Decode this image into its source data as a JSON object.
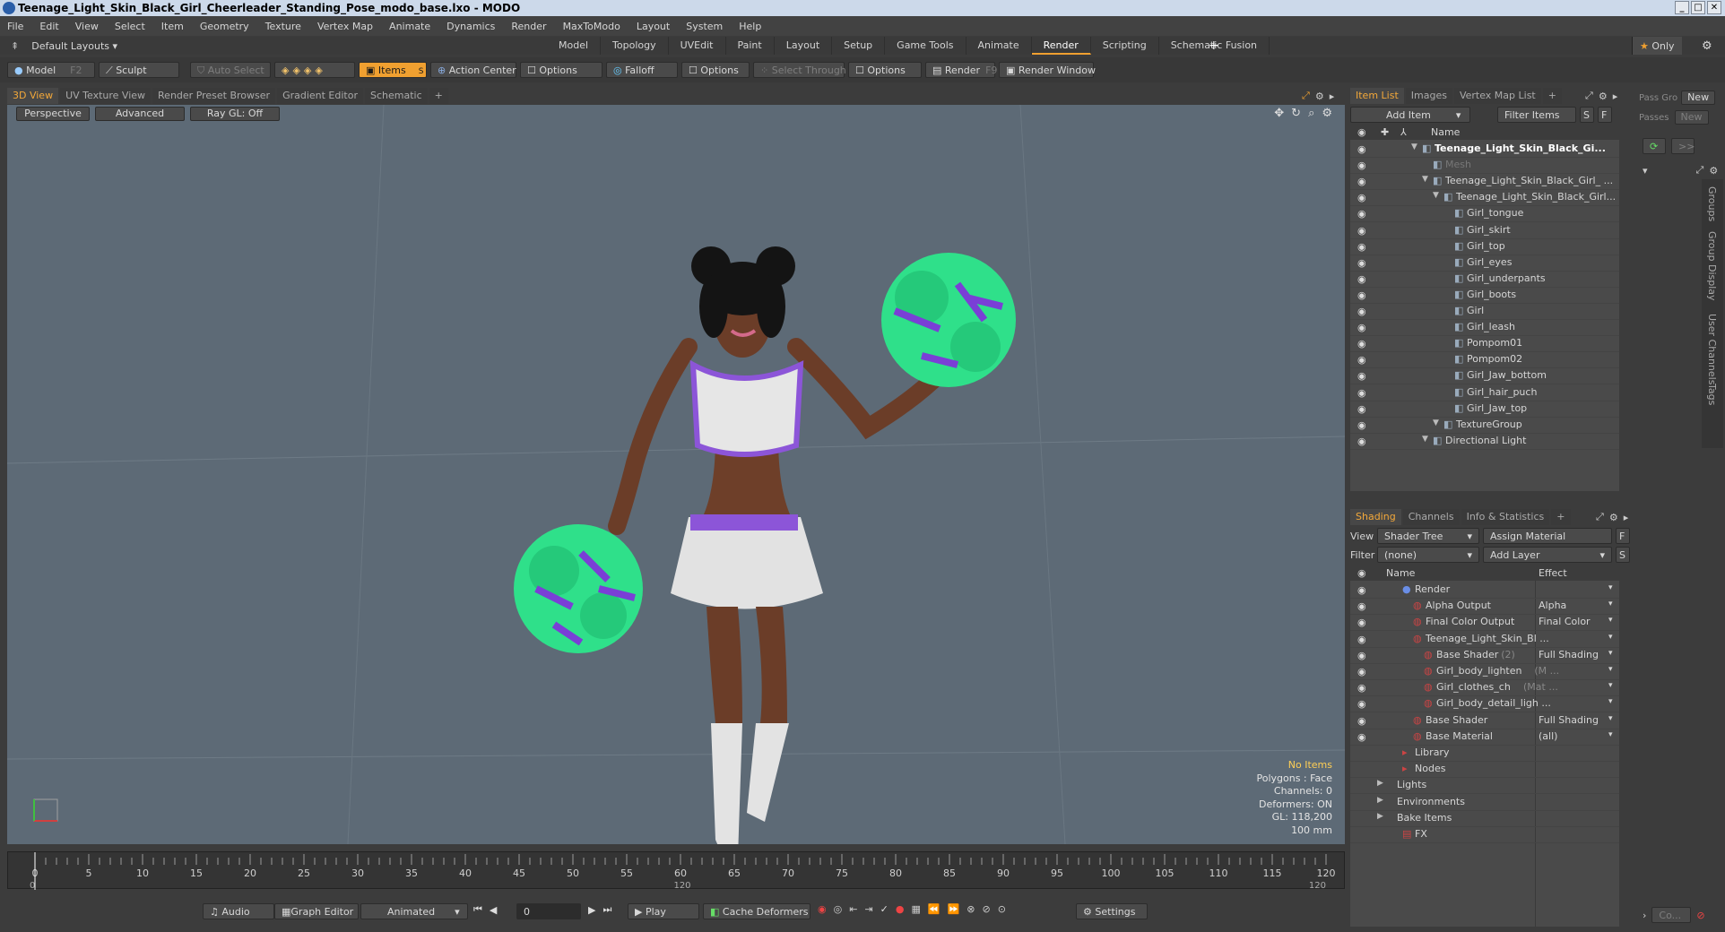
{
  "window": {
    "title": "Teenage_Light_Skin_Black_Girl_Cheerleader_Standing_Pose_modo_base.lxo - MODO"
  },
  "menu": [
    "File",
    "Edit",
    "View",
    "Select",
    "Item",
    "Geometry",
    "Texture",
    "Vertex Map",
    "Animate",
    "Dynamics",
    "Render",
    "MaxToModo",
    "Layout",
    "System",
    "Help"
  ],
  "layout_selector": "Default Layouts",
  "top_tabs": [
    "Model",
    "Topology",
    "UVEdit",
    "Paint",
    "Layout",
    "Setup",
    "Game Tools",
    "Animate",
    "Render",
    "Scripting",
    "Schematic Fusion"
  ],
  "active_top_tab": "Render",
  "only_label": "Only",
  "toolbar": {
    "model": "Model",
    "model_key": "F2",
    "sculpt": "Sculpt",
    "auto_select": "Auto Select",
    "items": "Items",
    "items_key": "S",
    "action_center": "Action Center",
    "options1": "Options",
    "falloff": "Falloff",
    "options2": "Options",
    "select_through": "Select Through",
    "options3": "Options",
    "render": "Render",
    "render_key": "F9",
    "render_window": "Render Window"
  },
  "viewport_tabs": [
    "3D View",
    "UV Texture View",
    "Render Preset Browser",
    "Gradient Editor",
    "Schematic"
  ],
  "viewport_sub": {
    "perspective": "Perspective",
    "advanced": "Advanced",
    "raygl": "Ray GL: Off"
  },
  "viewport_info": {
    "no_items": "No Items",
    "polygons": "Polygons : Face",
    "channels": "Channels: 0",
    "deformers": "Deformers: ON",
    "gl": "GL: 118,200",
    "scale": "100 mm"
  },
  "right_tabs": [
    "Item List",
    "Images",
    "Vertex Map List"
  ],
  "item_list": {
    "add_item": "Add Item",
    "filter_items": "Filter Items",
    "s": "S",
    "f": "F",
    "name_header": "Name"
  },
  "items": [
    {
      "label": "Teenage_Light_Skin_Black_Gi...",
      "indent": 0,
      "bold": true
    },
    {
      "label": "Mesh",
      "indent": 1,
      "dim": true
    },
    {
      "label": "Teenage_Light_Skin_Black_Girl_ ...",
      "indent": 1
    },
    {
      "label": "Teenage_Light_Skin_Black_Girl...",
      "indent": 2
    },
    {
      "label": "Girl_tongue",
      "indent": 3
    },
    {
      "label": "Girl_skirt",
      "indent": 3
    },
    {
      "label": "Girl_top",
      "indent": 3
    },
    {
      "label": "Girl_eyes",
      "indent": 3
    },
    {
      "label": "Girl_underpants",
      "indent": 3
    },
    {
      "label": "Girl_boots",
      "indent": 3
    },
    {
      "label": "Girl",
      "indent": 3
    },
    {
      "label": "Girl_leash",
      "indent": 3
    },
    {
      "label": "Pompom01",
      "indent": 3
    },
    {
      "label": "Pompom02",
      "indent": 3
    },
    {
      "label": "Girl_Jaw_bottom",
      "indent": 3
    },
    {
      "label": "Girl_hair_puch",
      "indent": 3
    },
    {
      "label": "Girl_Jaw_top",
      "indent": 3
    },
    {
      "label": "TextureGroup",
      "indent": 2
    },
    {
      "label": "Directional Light",
      "indent": 1
    }
  ],
  "shading_tabs": [
    "Shading",
    "Channels",
    "Info & Statistics"
  ],
  "shading": {
    "view_label": "View",
    "view_value": "Shader Tree",
    "assign_material": "Assign Material",
    "f": "F",
    "filter_label": "Filter",
    "filter_value": "(none)",
    "add_layer": "Add Layer",
    "s": "S",
    "name_header": "Name",
    "effect_header": "Effect"
  },
  "shader_rows": [
    {
      "label": "Render",
      "effect": "",
      "indent": 0
    },
    {
      "label": "Alpha Output",
      "effect": "Alpha",
      "indent": 1
    },
    {
      "label": "Final Color Output",
      "effect": "Final Color",
      "indent": 1
    },
    {
      "label": "Teenage_Light_Skin_Bl ...",
      "effect": "",
      "indent": 1
    },
    {
      "label": "Base Shader",
      "suffix": "(2)",
      "effect": "Full Shading",
      "indent": 2
    },
    {
      "label": "Girl_body_lighten",
      "suffix": "(M ...",
      "effect": "",
      "indent": 2
    },
    {
      "label": "Girl_clothes_ch",
      "suffix": "(Mat ...",
      "effect": "",
      "indent": 2
    },
    {
      "label": "Girl_body_detail_ligh ...",
      "effect": "",
      "indent": 2
    },
    {
      "label": "Base Shader",
      "effect": "Full Shading",
      "indent": 1
    },
    {
      "label": "Base Material",
      "effect": "(all)",
      "indent": 1
    },
    {
      "label": "Library",
      "effect": "",
      "indent": 0
    },
    {
      "label": "Nodes",
      "effect": "",
      "indent": 0
    },
    {
      "label": "Lights",
      "effect": "",
      "indent": -1
    },
    {
      "label": "Environments",
      "effect": "",
      "indent": -1
    },
    {
      "label": "Bake Items",
      "effect": "",
      "indent": -1
    },
    {
      "label": "FX",
      "effect": "",
      "indent": 0
    }
  ],
  "far_right": {
    "pass_gro": "Pass Gro",
    "new1": "New",
    "passes": "Passes",
    "new2": "New",
    "gg": ">>",
    "vertical_tabs": [
      "Groups",
      "Group Display",
      "User Channels",
      "Tags"
    ],
    "co": "Co..."
  },
  "timeline": {
    "ticks": [
      0,
      5,
      10,
      15,
      20,
      25,
      30,
      35,
      40,
      45,
      50,
      55,
      60,
      65,
      70,
      75,
      80,
      85,
      90,
      95,
      100,
      105,
      110,
      115,
      120
    ],
    "start": "0",
    "mid": "120",
    "end": "120"
  },
  "bottom": {
    "audio": "Audio",
    "graph_editor": "Graph Editor",
    "animated": "Animated",
    "frame": "0",
    "play": "Play",
    "cache_deformers": "Cache Deformers",
    "settings": "Settings"
  },
  "colors": {
    "accent": "#f0a030",
    "viewport": "#5d6a76",
    "pompom": "#2fe08a",
    "purple": "#7a3fd6"
  }
}
